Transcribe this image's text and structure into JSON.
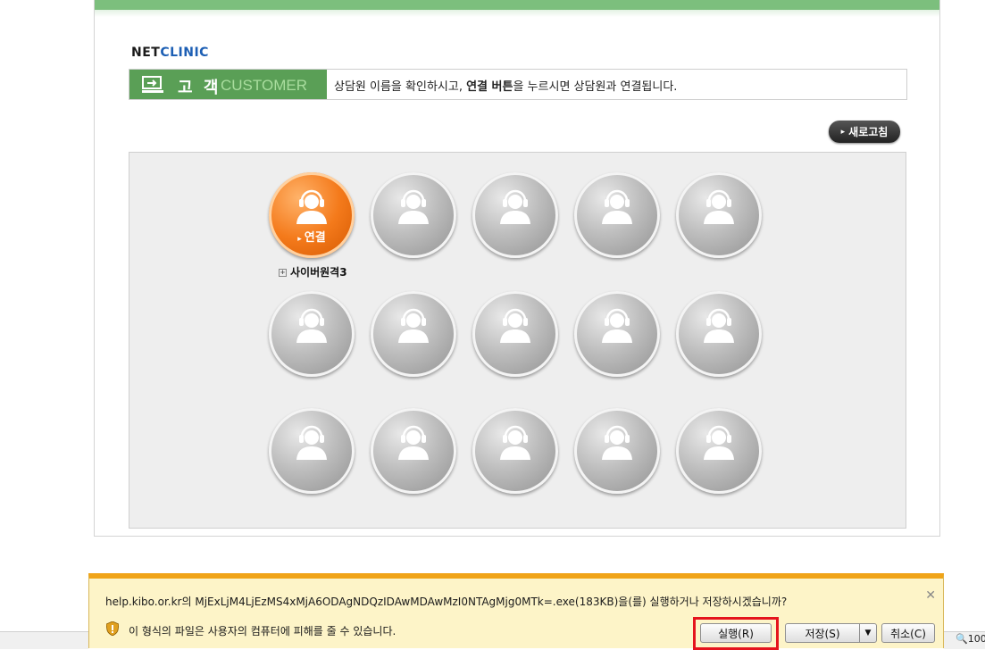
{
  "logo": {
    "net": "NET",
    "clinic": "CLINIC"
  },
  "customer_bar": {
    "label_kor": "고 객",
    "label_eng": "CUSTOMER",
    "message_pre": "상담원 이름을 확인하시고, ",
    "message_bold": "연결 버튼",
    "message_post": "을 누르시면 상담원과 연결됩니다."
  },
  "refresh_button": {
    "label": "새로고침"
  },
  "agents": {
    "connect_label": "연결",
    "active_agent_name": "사이버원격3"
  },
  "download_bar": {
    "host": "help.kibo.or.kr",
    "host_suffix": "의 ",
    "filename": "MjExLjM4LjEzMS4xMjA6ODAgNDQzIDAwMDAwMzI0NTAgMjg0MTk=.exe",
    "size_and_question": "(183KB)을(를) 실행하거나 저장하시겠습니까?",
    "warning": "이 형식의 파일은 사용자의 컴퓨터에 피해를 줄 수 있습니다.",
    "run_label": "실행(R)",
    "save_label": "저장(S)",
    "cancel_label": "취소(C)"
  },
  "status": {
    "zoom": "100"
  },
  "colors": {
    "accent_green": "#5a9f56",
    "orange": "#f47a1b",
    "highlight_red": "#e5141d"
  }
}
